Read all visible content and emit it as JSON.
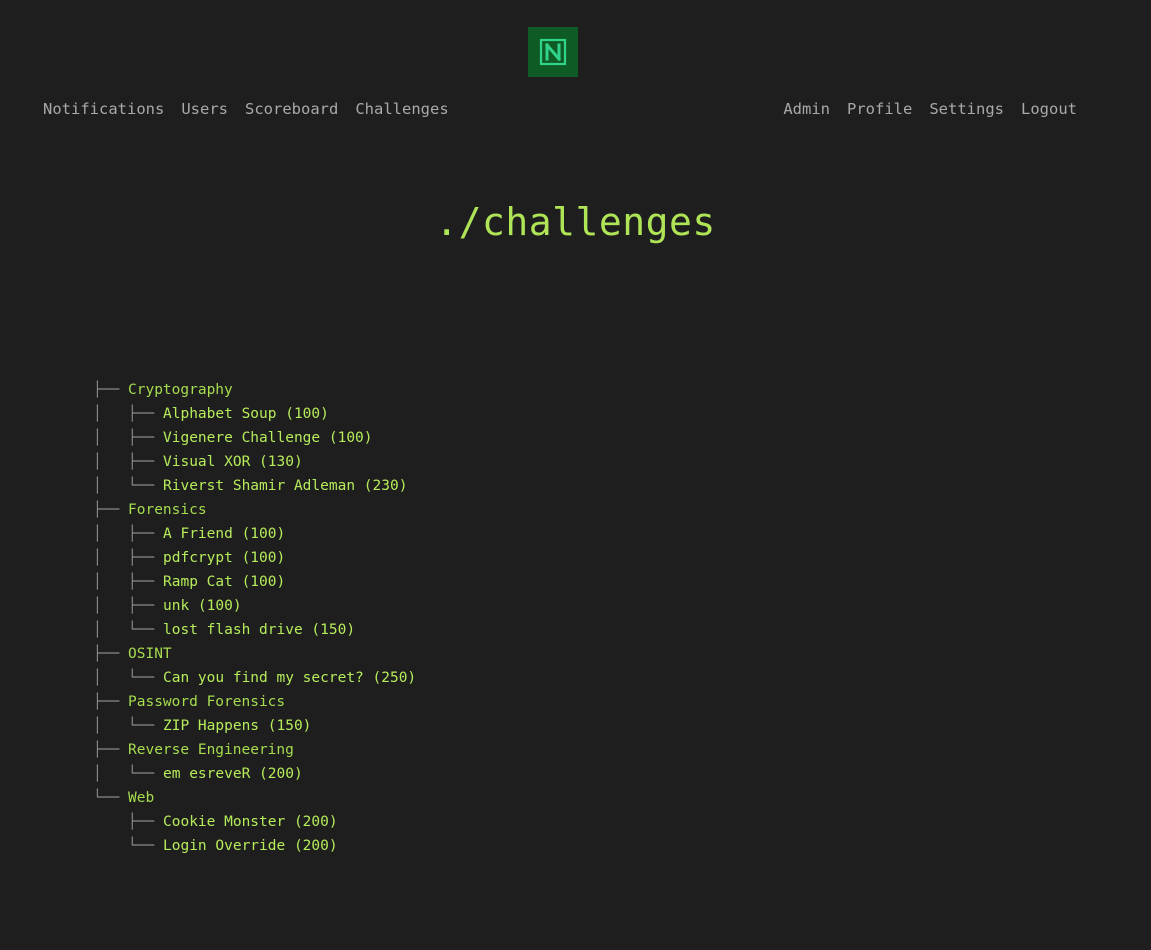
{
  "logo": {
    "icon": "n-logo-icon",
    "accent": "#0f5b25"
  },
  "nav": {
    "left": [
      {
        "label": "Notifications"
      },
      {
        "label": "Users"
      },
      {
        "label": "Scoreboard"
      },
      {
        "label": "Challenges"
      }
    ],
    "right": [
      {
        "label": "Admin"
      },
      {
        "label": "Profile"
      },
      {
        "label": "Settings"
      },
      {
        "label": "Logout"
      }
    ]
  },
  "page": {
    "title": "./challenges"
  },
  "tree": {
    "categories": [
      {
        "name": "Cryptography",
        "challenges": [
          "Alphabet Soup (100)",
          "Vigenere Challenge (100)",
          "Visual XOR (130)",
          "Riverst Shamir Adleman (230)"
        ]
      },
      {
        "name": "Forensics",
        "challenges": [
          "A Friend (100)",
          "pdfcrypt (100)",
          "Ramp Cat (100)",
          "unk (100)",
          "lost flash drive (150)"
        ]
      },
      {
        "name": "OSINT",
        "challenges": [
          "Can you find my secret? (250)"
        ]
      },
      {
        "name": "Password Forensics",
        "challenges": [
          "ZIP Happens (150)"
        ]
      },
      {
        "name": "Reverse Engineering",
        "challenges": [
          "em esreveR (200)"
        ]
      },
      {
        "name": "Web",
        "challenges": [
          "Cookie Monster (200)",
          "Login Override (200)"
        ]
      }
    ]
  },
  "colors": {
    "background": "#1e1e1e",
    "nav_text": "#a9a9a9",
    "title": "#aee456",
    "tree_text": "#b6ec5a",
    "tree_lines": "#8a8a8a"
  }
}
